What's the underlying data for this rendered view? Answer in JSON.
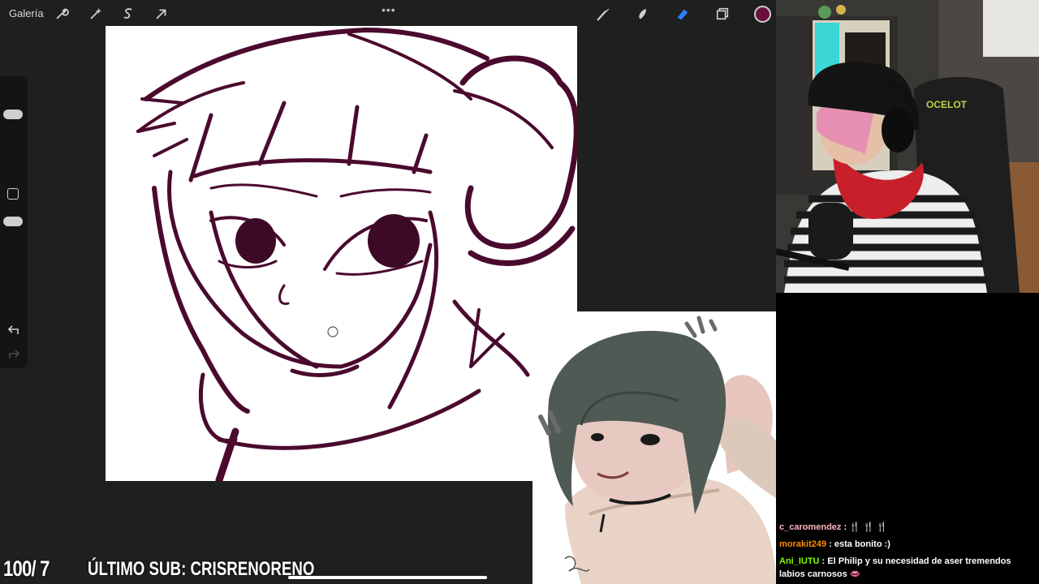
{
  "toolbar": {
    "gallery_label": "Galería",
    "more_label": "•••",
    "left_icons": [
      "wrench-icon",
      "magic-wand-icon",
      "selection-icon",
      "transform-arrow-icon"
    ],
    "right_icons": [
      "brush-icon",
      "smudge-icon",
      "eraser-icon",
      "layers-icon"
    ],
    "active_color": "#6a0f3e"
  },
  "sidebar": {
    "icons": [
      "brush-size-slider",
      "modify-square-icon",
      "opacity-slider",
      "undo-icon",
      "redo-icon"
    ]
  },
  "overlay": {
    "counter": "100/ 7",
    "last_sub": "ÚLTIMO SUB: CRISRENORENO"
  },
  "chat": {
    "messages": [
      {
        "user": "c_caromendez",
        "user_color": "#ffb3c1",
        "text": "🍴 🍴 🍴"
      },
      {
        "user": "morakit249",
        "user_color": "#ff8c00",
        "text": "esta bonito :)"
      },
      {
        "user": "Ani_IUTU",
        "user_color": "#7fff00",
        "text": "El Philip y su necesidad de aser tremendos labios carnosos 👄"
      }
    ]
  },
  "colors": {
    "app_bg": "#1e1f1f",
    "ink": "#4a0a2e",
    "accent_eraser": "#2f7dff"
  }
}
